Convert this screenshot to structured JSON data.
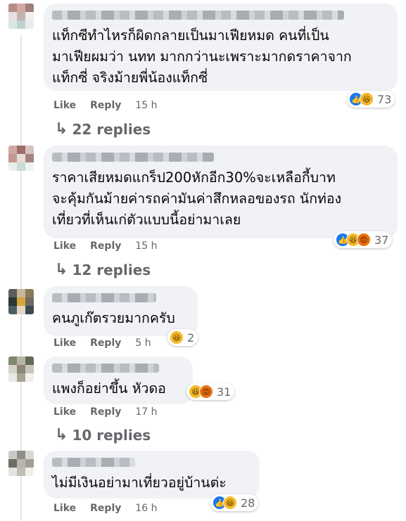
{
  "actions": {
    "like_label": "Like",
    "reply_label": "Reply"
  },
  "comments": [
    {
      "text": "แท็กซีทำไหรก็ผิดกลายเป็นมาเฟียหมด คนที่เป็น\nมาเฟียผมว่า นทท มากกว่านะเพราะมากดราคาจาก\nแท็กซี่ จริงม้ายพี่น้องแท็กซี่",
      "time": "15 h",
      "reactions": [
        "like",
        "haha"
      ],
      "reaction_count": "73",
      "replies": "22 replies"
    },
    {
      "text": "ราคาเสียหมดแกร็ป200หักอีก30%จะเหลือกี้บาท\nจะคุ้มกันม้ายค่ารถค่ามันค่าสึกหลอของรถ นักท่อง\nเที่ยวที่เห็นเก่ตัวแบบนี้อย่ามาเลย",
      "time": "15 h",
      "reactions": [
        "like",
        "haha",
        "angry"
      ],
      "reaction_count": "37",
      "replies": "12 replies"
    },
    {
      "text": "คนภูเก๊ตรวยมากครับ",
      "time": "5 h",
      "reactions": [
        "haha"
      ],
      "reaction_count": "2",
      "replies": ""
    },
    {
      "text": "แพงก็อย่าขึ้น หัวดอ",
      "time": "17 h",
      "reactions": [
        "haha",
        "angry"
      ],
      "reaction_count": "31",
      "replies": "10 replies"
    },
    {
      "text": "ไม่มีเงินอย่ามาเที่ยวอยู่บ้านต่ะ",
      "time": "16 h",
      "reactions": [
        "like",
        "haha"
      ],
      "reaction_count": "28",
      "replies": ""
    }
  ],
  "colors": {
    "like": "#1877f2",
    "haha": "#f7b928",
    "angry": "#e9710f",
    "bubble": "#f0f2f5",
    "meta": "#65676b"
  }
}
